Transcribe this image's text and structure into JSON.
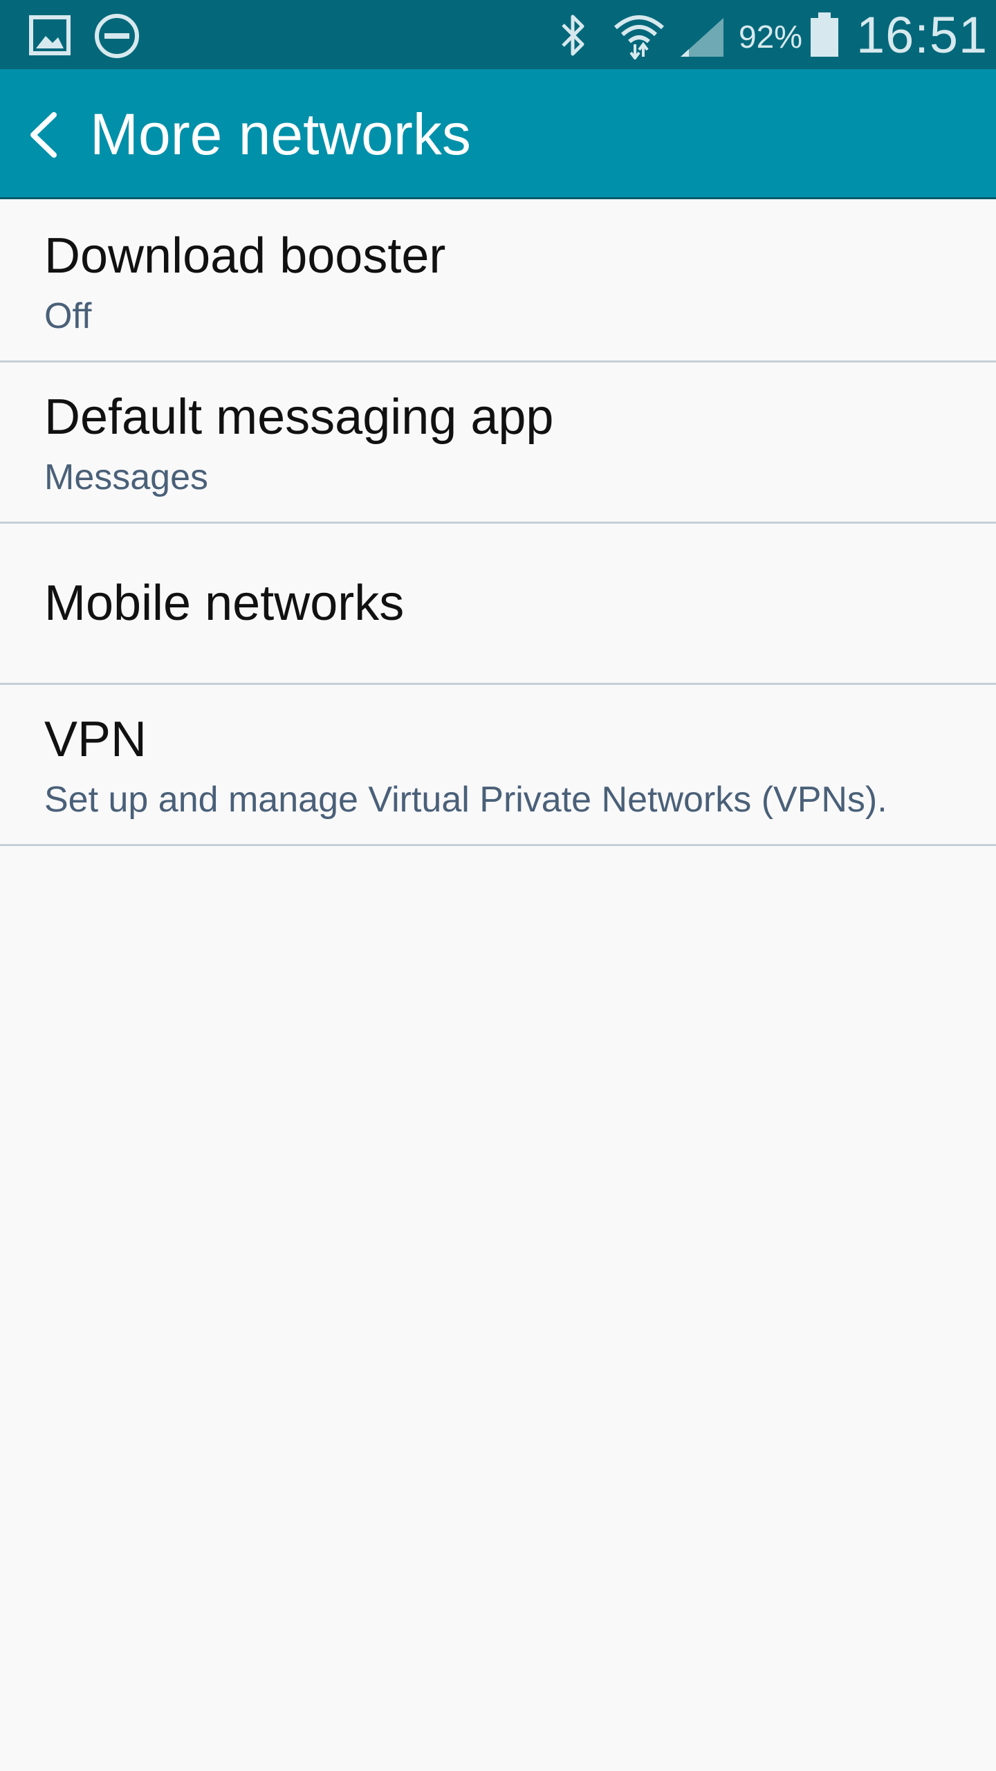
{
  "status_bar": {
    "battery_percent": "92%",
    "time": "16:51",
    "icons": [
      "gallery-icon",
      "do-not-disturb-icon",
      "bluetooth-icon",
      "wifi-icon",
      "signal-icon",
      "battery-icon"
    ],
    "battery_level": 0.92
  },
  "app_bar": {
    "title": "More networks",
    "back_icon": "chevron-left-icon"
  },
  "items": [
    {
      "title": "Download booster",
      "summary": "Off"
    },
    {
      "title": "Default messaging app",
      "summary": "Messages"
    },
    {
      "title": "Mobile networks"
    },
    {
      "title": "VPN",
      "summary": "Set up and manage Virtual Private Networks (VPNs)."
    }
  ],
  "colors": {
    "status_bar": "#04687a",
    "app_bar": "#0190aa",
    "background": "#f9f9fa",
    "summary_text": "#4a6078",
    "divider": "#c6cfd6"
  }
}
